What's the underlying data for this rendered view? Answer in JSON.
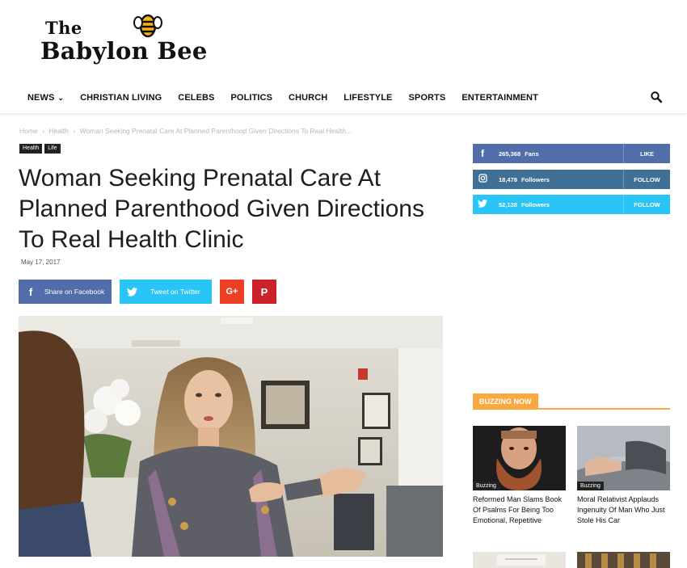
{
  "logo": {
    "line1": "The",
    "line2": "Babylon Bee"
  },
  "nav": {
    "items": [
      {
        "label": "NEWS",
        "has_dropdown": true
      },
      {
        "label": "CHRISTIAN LIVING"
      },
      {
        "label": "CELEBS"
      },
      {
        "label": "POLITICS"
      },
      {
        "label": "CHURCH"
      },
      {
        "label": "LIFESTYLE"
      },
      {
        "label": "SPORTS"
      },
      {
        "label": "ENTERTAINMENT"
      }
    ],
    "search_icon": "search-icon"
  },
  "breadcrumb": {
    "home": "Home",
    "sep": "›",
    "category": "Health",
    "current": "Woman Seeking Prenatal Care At Planned Parenthood Given Directions To Real Health..."
  },
  "tags": [
    "Health",
    "Life"
  ],
  "article": {
    "title": "Woman Seeking Prenatal Care At Planned Parenthood Given Directions To Real Health Clinic",
    "date": "May 17, 2017"
  },
  "share": {
    "facebook": "Share on Facebook",
    "twitter": "Tweet on Twitter",
    "googleplus": "G+",
    "pinterest": "P"
  },
  "social": [
    {
      "network": "facebook",
      "icon": "f",
      "count": "265,368",
      "label": "Fans",
      "action": "LIKE",
      "color": "#516eab"
    },
    {
      "network": "instagram",
      "icon": "instagram-icon",
      "count": "18,478",
      "label": "Followers",
      "action": "FOLLOW",
      "color": "#417096"
    },
    {
      "network": "twitter",
      "icon": "twitter-icon",
      "count": "52,138",
      "label": "Followers",
      "action": "FOLLOW",
      "color": "#29c5f6"
    }
  ],
  "buzzing": {
    "heading": "BUZZING NOW",
    "accent": "#f9a940",
    "items": [
      {
        "badge": "Buzzing",
        "title": "Reformed Man Slams Book Of Psalms For Being Too Emotional, Repetitive"
      },
      {
        "badge": "Buzzing",
        "title": "Moral Relativist Applauds Ingenuity Of Man Who Just Stole His Car"
      }
    ]
  }
}
